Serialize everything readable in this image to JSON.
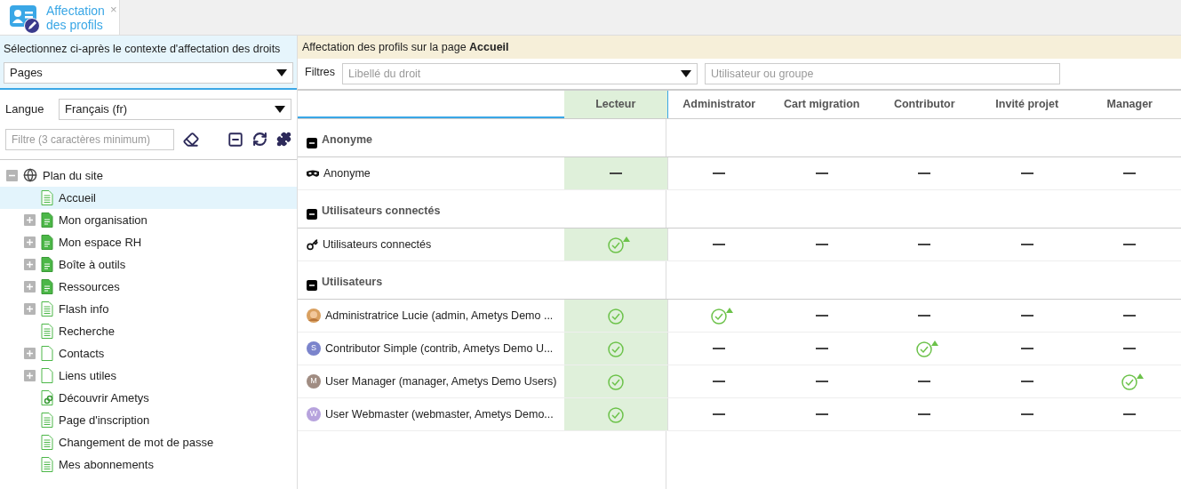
{
  "tab": {
    "title_line1": "Affectation",
    "title_line2": "des profils",
    "close": "×"
  },
  "context": {
    "label": "Sélectionnez ci-après le contexte d'affectation des droits",
    "value": "Pages"
  },
  "language": {
    "label": "Langue",
    "value": "Français (fr)"
  },
  "tree_filter": {
    "placeholder": "Filtre (3 caractères minimum)"
  },
  "tree": [
    {
      "label": "Plan du site",
      "kind": "globe",
      "expandable": true,
      "expanded": true,
      "selected": false,
      "children": [
        {
          "label": "Accueil",
          "kind": "page",
          "expandable": false,
          "selected": true
        },
        {
          "label": "Mon organisation",
          "kind": "section",
          "expandable": true,
          "expanded": false,
          "selected": false
        },
        {
          "label": "Mon espace RH",
          "kind": "section",
          "expandable": true,
          "expanded": false,
          "selected": false
        },
        {
          "label": "Boîte à outils",
          "kind": "section",
          "expandable": true,
          "expanded": false,
          "selected": false
        },
        {
          "label": "Ressources",
          "kind": "section",
          "expandable": true,
          "expanded": false,
          "selected": false
        },
        {
          "label": "Flash info",
          "kind": "page",
          "expandable": true,
          "expanded": false,
          "selected": false
        },
        {
          "label": "Recherche",
          "kind": "page",
          "expandable": false,
          "selected": false
        },
        {
          "label": "Contacts",
          "kind": "blank",
          "expandable": true,
          "expanded": false,
          "selected": false
        },
        {
          "label": "Liens utiles",
          "kind": "blank",
          "expandable": true,
          "expanded": false,
          "selected": false
        },
        {
          "label": "Découvrir Ametys",
          "kind": "link",
          "expandable": false,
          "selected": false
        },
        {
          "label": "Page d'inscription",
          "kind": "page",
          "expandable": false,
          "selected": false
        },
        {
          "label": "Changement de mot de passe",
          "kind": "page",
          "expandable": false,
          "selected": false
        },
        {
          "label": "Mes abonnements",
          "kind": "page",
          "expandable": false,
          "selected": false
        }
      ]
    }
  ],
  "heading": {
    "prefix": "Affectation des profils sur la page",
    "page": "Accueil"
  },
  "filters": {
    "label": "Filtres",
    "right_placeholder": "Libellé du droit",
    "user_placeholder": "Utilisateur ou groupe"
  },
  "columns": [
    {
      "label": "Lecteur",
      "selected": true
    },
    {
      "label": "Administrator",
      "selected": false
    },
    {
      "label": "Cart migration",
      "selected": false
    },
    {
      "label": "Contributor",
      "selected": false
    },
    {
      "label": "Invité projet",
      "selected": false
    },
    {
      "label": "Manager",
      "selected": false
    }
  ],
  "groups": [
    {
      "label": "Anonyme",
      "expanded": true,
      "rows": [
        {
          "label": "Anonyme",
          "kind": "mask",
          "cells": [
            {
              "kind": "none"
            },
            {
              "kind": "none"
            },
            {
              "kind": "none"
            },
            {
              "kind": "none"
            },
            {
              "kind": "none"
            },
            {
              "kind": "none"
            }
          ]
        }
      ]
    },
    {
      "label": "Utilisateurs connectés",
      "expanded": true,
      "rows": [
        {
          "label": "Utilisateurs connectés",
          "kind": "key",
          "cells": [
            {
              "kind": "local"
            },
            {
              "kind": "none"
            },
            {
              "kind": "none"
            },
            {
              "kind": "none"
            },
            {
              "kind": "none"
            },
            {
              "kind": "none"
            }
          ]
        }
      ]
    },
    {
      "label": "Utilisateurs",
      "expanded": true,
      "rows": [
        {
          "label": "Administratrice Lucie (admin, Ametys Demo ...",
          "cells": [
            {
              "kind": "inherited"
            },
            {
              "kind": "local"
            },
            {
              "kind": "none"
            },
            {
              "kind": "none"
            },
            {
              "kind": "none"
            },
            {
              "kind": "none"
            }
          ]
        },
        {
          "label": "Contributor Simple (contrib, Ametys Demo U...",
          "kind": "letter",
          "letter": "S",
          "color": "#7b84cc",
          "cells": [
            {
              "kind": "inherited"
            },
            {
              "kind": "none"
            },
            {
              "kind": "none"
            },
            {
              "kind": "local"
            },
            {
              "kind": "none"
            },
            {
              "kind": "none"
            }
          ]
        },
        {
          "label": "User Manager (manager, Ametys Demo Users)",
          "kind": "letter",
          "letter": "M",
          "color": "#a08c82",
          "cells": [
            {
              "kind": "inherited"
            },
            {
              "kind": "none"
            },
            {
              "kind": "none"
            },
            {
              "kind": "none"
            },
            {
              "kind": "none"
            },
            {
              "kind": "local"
            }
          ]
        },
        {
          "label": "User Webmaster (webmaster, Ametys Demo...",
          "kind": "letter",
          "letter": "W",
          "color": "#b7a3dd",
          "cells": [
            {
              "kind": "inherited"
            },
            {
              "kind": "none"
            },
            {
              "kind": "none"
            },
            {
              "kind": "none"
            },
            {
              "kind": "none"
            },
            {
              "kind": "none"
            }
          ]
        }
      ]
    }
  ]
}
